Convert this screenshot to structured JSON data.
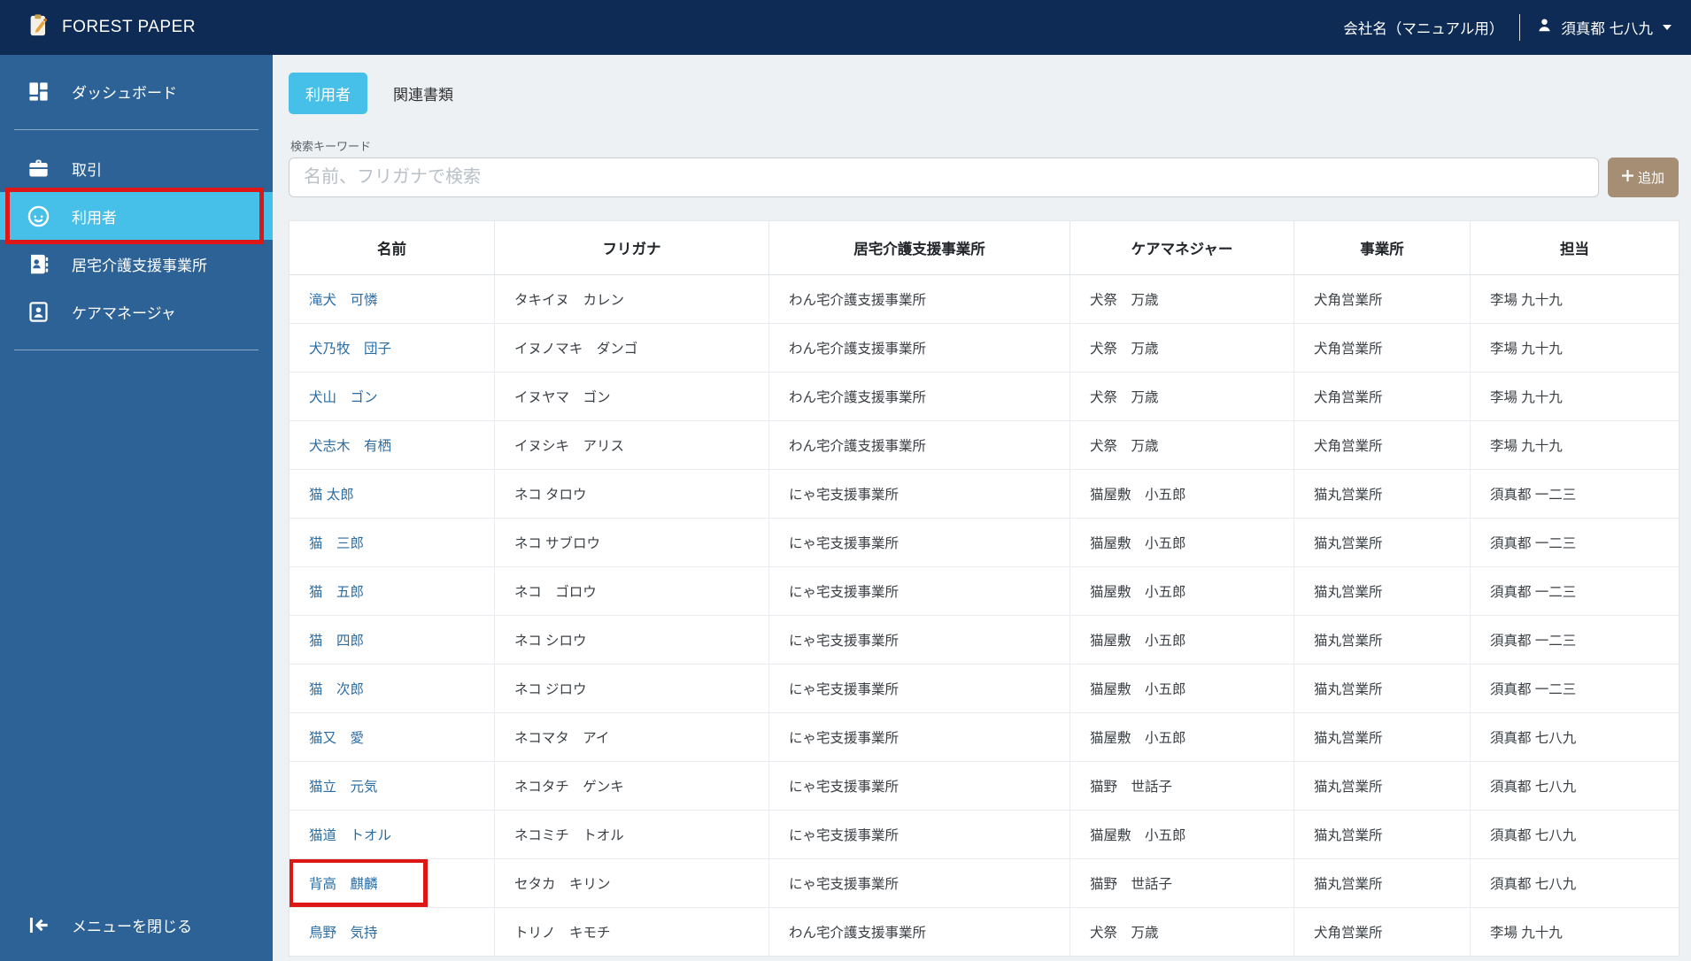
{
  "navbar": {
    "brand": "FOREST PAPER",
    "company": "会社名（マニュアル用）",
    "user": "須真都 七八九"
  },
  "sidebar": {
    "items": [
      {
        "label": "ダッシュボード",
        "icon": "dashboard-icon",
        "active": false
      },
      {
        "label": "取引",
        "icon": "briefcase-icon",
        "active": false
      },
      {
        "label": "利用者",
        "icon": "face-icon",
        "active": true,
        "annotated": true
      },
      {
        "label": "居宅介護支援事業所",
        "icon": "office-card-icon",
        "active": false
      },
      {
        "label": "ケアマネージャ",
        "icon": "care-manager-badge-icon",
        "active": false
      }
    ],
    "close_menu": "メニューを閉じる"
  },
  "tabs": [
    {
      "label": "利用者",
      "active": true
    },
    {
      "label": "関連書類",
      "active": false
    }
  ],
  "search": {
    "label": "検索キーワード",
    "placeholder": "名前、フリガナで検索",
    "value": ""
  },
  "add_button": {
    "label": "追加",
    "icon": "plus-icon"
  },
  "table": {
    "headers": [
      "名前",
      "フリガナ",
      "居宅介護支援事業所",
      "ケアマネジャー",
      "事業所",
      "担当"
    ],
    "rows": [
      {
        "name": "滝犬　可憐",
        "furigana": "タキイヌ　カレン",
        "office": "わん宅介護支援事業所",
        "care_manager": "犬祭　万歳",
        "branch": "犬角営業所",
        "staff": "李場 九十九"
      },
      {
        "name": "犬乃牧　団子",
        "furigana": "イヌノマキ　ダンゴ",
        "office": "わん宅介護支援事業所",
        "care_manager": "犬祭　万歳",
        "branch": "犬角営業所",
        "staff": "李場 九十九"
      },
      {
        "name": "犬山　ゴン",
        "furigana": "イヌヤマ　ゴン",
        "office": "わん宅介護支援事業所",
        "care_manager": "犬祭　万歳",
        "branch": "犬角営業所",
        "staff": "李場 九十九"
      },
      {
        "name": "犬志木　有栖",
        "furigana": "イヌシキ　アリス",
        "office": "わん宅介護支援事業所",
        "care_manager": "犬祭　万歳",
        "branch": "犬角営業所",
        "staff": "李場 九十九"
      },
      {
        "name": "猫 太郎",
        "furigana": "ネコ タロウ",
        "office": "にゃ宅支援事業所",
        "care_manager": "猫屋敷　小五郎",
        "branch": "猫丸営業所",
        "staff": "須真都 一二三"
      },
      {
        "name": "猫　三郎",
        "furigana": "ネコ サブロウ",
        "office": "にゃ宅支援事業所",
        "care_manager": "猫屋敷　小五郎",
        "branch": "猫丸営業所",
        "staff": "須真都 一二三"
      },
      {
        "name": "猫　五郎",
        "furigana": "ネコ　ゴロウ",
        "office": "にゃ宅支援事業所",
        "care_manager": "猫屋敷　小五郎",
        "branch": "猫丸営業所",
        "staff": "須真都 一二三"
      },
      {
        "name": "猫　四郎",
        "furigana": "ネコ シロウ",
        "office": "にゃ宅支援事業所",
        "care_manager": "猫屋敷　小五郎",
        "branch": "猫丸営業所",
        "staff": "須真都 一二三"
      },
      {
        "name": "猫　次郎",
        "furigana": "ネコ ジロウ",
        "office": "にゃ宅支援事業所",
        "care_manager": "猫屋敷　小五郎",
        "branch": "猫丸営業所",
        "staff": "須真都 一二三"
      },
      {
        "name": "猫又　愛",
        "furigana": "ネコマタ　アイ",
        "office": "にゃ宅支援事業所",
        "care_manager": "猫屋敷　小五郎",
        "branch": "猫丸営業所",
        "staff": "須真都 七八九"
      },
      {
        "name": "猫立　元気",
        "furigana": "ネコタチ　ゲンキ",
        "office": "にゃ宅支援事業所",
        "care_manager": "猫野　世話子",
        "branch": "猫丸営業所",
        "staff": "須真都 七八九"
      },
      {
        "name": "猫道　トオル",
        "furigana": "ネコミチ　トオル",
        "office": "にゃ宅支援事業所",
        "care_manager": "猫屋敷　小五郎",
        "branch": "猫丸営業所",
        "staff": "須真都 七八九"
      },
      {
        "name": "背高　麒麟",
        "furigana": "セタカ　キリン",
        "office": "にゃ宅支援事業所",
        "care_manager": "猫野　世話子",
        "branch": "猫丸営業所",
        "staff": "須真都 七八九",
        "annotated": true
      },
      {
        "name": "鳥野　気持",
        "furigana": "トリノ　キモチ",
        "office": "わん宅介護支援事業所",
        "care_manager": "犬祭　万歳",
        "branch": "犬角営業所",
        "staff": "李場 九十九"
      }
    ]
  },
  "annotations": {
    "highlight_color": "#dd1616",
    "highlighted_sidebar_item": "利用者",
    "highlighted_row_name": "背高　麒麟"
  },
  "colors": {
    "navbar_bg": "#0d2b55",
    "sidebar_bg": "#2d6296",
    "accent_active": "#47c0e9",
    "add_button_bg": "#a68e75",
    "link_blue": "#2b6ca3",
    "page_bg": "#eef1f4"
  }
}
